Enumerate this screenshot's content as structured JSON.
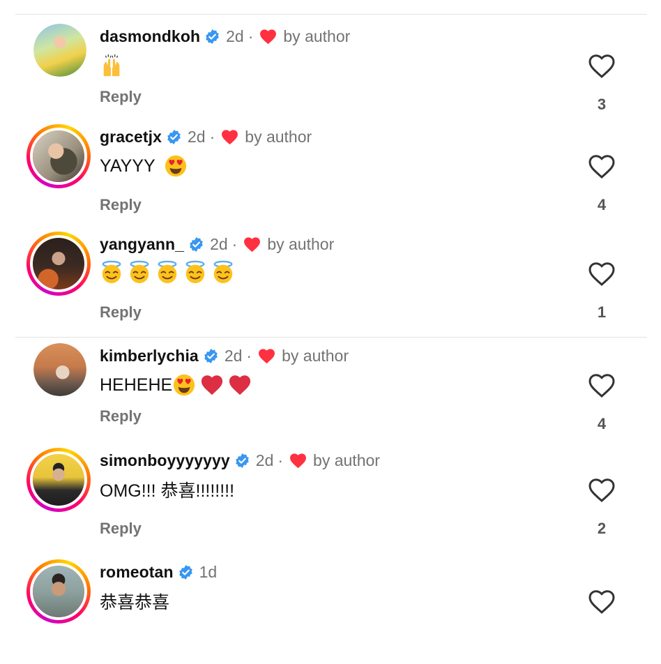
{
  "labels": {
    "reply": "Reply",
    "by_author": "by author",
    "separator": "·"
  },
  "colors": {
    "verified": "#3897f0",
    "author_heart": "#ff3040",
    "secondary_text": "#737373",
    "story_ring": [
      "#d300c5",
      "#ff0069",
      "#ff7a00",
      "#ffd600"
    ]
  },
  "comments": [
    {
      "username": "dasmondkoh",
      "verified": true,
      "time": "2d",
      "liked_by_author": true,
      "text": "",
      "emojis": [
        "raising-hands-emoji"
      ],
      "has_story_ring": false,
      "likes": "3"
    },
    {
      "username": "gracetjx",
      "verified": true,
      "time": "2d",
      "liked_by_author": true,
      "text": "YAYYY",
      "emojis": [
        "heart-eyes-emoji"
      ],
      "has_story_ring": true,
      "likes": "4"
    },
    {
      "username": "yangyann_",
      "verified": true,
      "time": "2d",
      "liked_by_author": true,
      "text": "",
      "emojis": [
        "halo-emoji",
        "halo-emoji",
        "halo-emoji",
        "halo-emoji",
        "halo-emoji"
      ],
      "has_story_ring": true,
      "likes": "1"
    },
    {
      "username": "kimberlychia",
      "verified": true,
      "time": "2d",
      "liked_by_author": true,
      "text": "HEHEHE",
      "emojis": [
        "heart-eyes-emoji",
        "red-heart-emoji",
        "red-heart-emoji"
      ],
      "has_story_ring": false,
      "likes": "4"
    },
    {
      "username": "simonboyyyyyyy",
      "verified": true,
      "time": "2d",
      "liked_by_author": true,
      "text": "OMG!!! 恭喜!!!!!!!!",
      "emojis": [],
      "has_story_ring": true,
      "likes": "2"
    },
    {
      "username": "romeotan",
      "verified": true,
      "time": "1d",
      "liked_by_author": false,
      "text": "恭喜恭喜",
      "emojis": [],
      "has_story_ring": true,
      "likes": ""
    }
  ]
}
